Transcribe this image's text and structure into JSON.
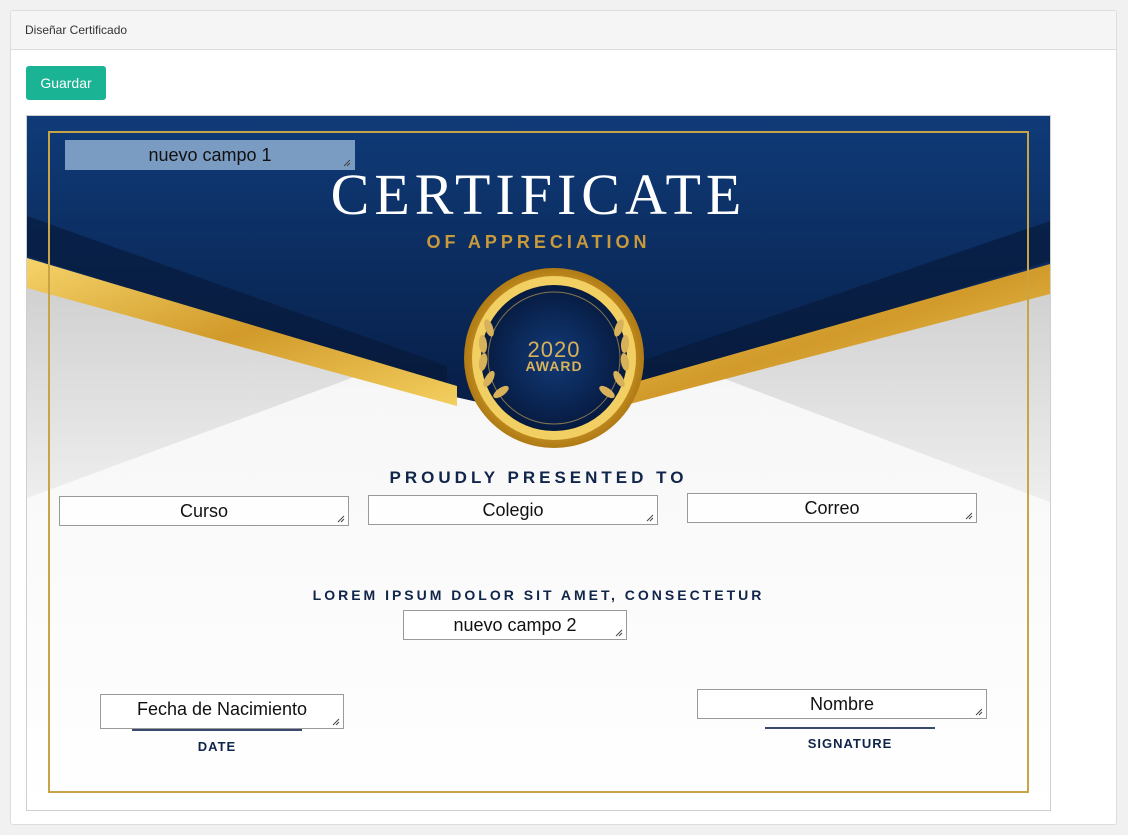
{
  "panel": {
    "header_title": "Diseñar Certificado",
    "save_label": "Guardar"
  },
  "certificate": {
    "title": "CERTIFICATE",
    "subtitle": "OF APPRECIATION",
    "badge_year": "2020",
    "badge_award": "AWARD",
    "presented_to": "PROUDLY PRESENTED TO",
    "lorem": "LOREM IPSUM DOLOR SIT AMET, CONSECTETUR",
    "date_label": "DATE",
    "signature_label": "SIGNATURE"
  },
  "fields": {
    "nuevo_campo_1": "nuevo campo 1",
    "curso": "Curso",
    "colegio": "Colegio",
    "correo": "Correo",
    "nuevo_campo_2": "nuevo campo 2",
    "fecha_nacimiento": "Fecha de Nacimiento",
    "nombre": "Nombre"
  },
  "colors": {
    "primary_button": "#1ab394",
    "cert_blue": "#0b2e63",
    "gold": "#d9a93a"
  },
  "icons": {
    "resize_grip": "resize-grip-icon",
    "laurel": "laurel-wreath-icon",
    "seal": "award-seal-icon"
  }
}
